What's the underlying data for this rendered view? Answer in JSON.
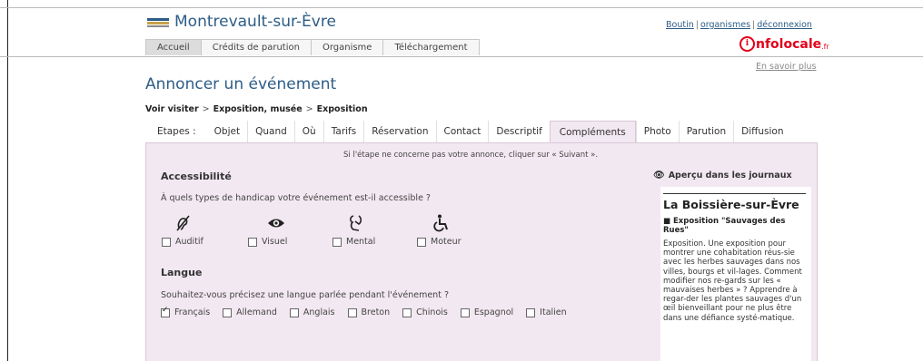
{
  "header": {
    "site_title": "Montrevault-sur-Èvre",
    "top_links": [
      "Boutin",
      "organismes",
      "déconnexion"
    ],
    "brand": {
      "badge": "i",
      "name": "nfolocale",
      "suffix": ".fr",
      "color": "#e2001a"
    },
    "more_link": "En savoir plus",
    "nav_tabs": [
      {
        "label": "Accueil",
        "active": true
      },
      {
        "label": "Crédits de parution",
        "active": false
      },
      {
        "label": "Organisme",
        "active": false
      },
      {
        "label": "Téléchargement",
        "active": false
      }
    ]
  },
  "page_title": "Annoncer un événement",
  "breadcrumb": [
    "Voir visiter",
    "Exposition, musée",
    "Exposition"
  ],
  "steps": {
    "label": "Etapes :",
    "items": [
      "Objet",
      "Quand",
      "Où",
      "Tarifs",
      "Réservation",
      "Contact",
      "Descriptif",
      "Compléments",
      "Photo",
      "Parution",
      "Diffusion"
    ],
    "active": "Compléments"
  },
  "hint": "Si l'étape ne concerne pas votre annonce, cliquer sur « Suivant ».",
  "accessibility": {
    "title": "Accessibilité",
    "question": "À quels types de handicap votre événement est-il accessible ?",
    "options": [
      {
        "label": "Auditif",
        "icon": "hearing-impaired-icon",
        "glyph": "ℬ",
        "checked": false
      },
      {
        "label": "Visuel",
        "icon": "eye-icon",
        "glyph": "◉",
        "checked": false
      },
      {
        "label": "Mental",
        "icon": "mental-disability-icon",
        "glyph": "☺",
        "checked": false
      },
      {
        "label": "Moteur",
        "icon": "wheelchair-icon",
        "glyph": "♿",
        "checked": false
      }
    ]
  },
  "language": {
    "title": "Langue",
    "question": "Souhaitez-vous précisez une langue parlée pendant l'événement ?",
    "options": [
      {
        "label": "Français",
        "checked": true
      },
      {
        "label": "Allemand",
        "checked": false
      },
      {
        "label": "Anglais",
        "checked": false
      },
      {
        "label": "Breton",
        "checked": false
      },
      {
        "label": "Chinois",
        "checked": false
      },
      {
        "label": "Espagnol",
        "checked": false
      },
      {
        "label": "Italien",
        "checked": false
      }
    ]
  },
  "preview": {
    "heading": "Aperçu dans les journaux",
    "town": "La Boissière-sur-Èvre",
    "event_title": "■ Exposition \"Sauvages des Rues\"",
    "body": "Exposition. Une exposition pour montrer une cohabitation réus-sie avec les herbes sauvages dans nos villes, bourgs et vil-lages. Comment modifier nos re-gards sur les « mauvaises herbes » ? Apprendre à regar-der les plantes sauvages d'un œil bienveillant pour ne plus être dans une défiance systé-matique."
  }
}
